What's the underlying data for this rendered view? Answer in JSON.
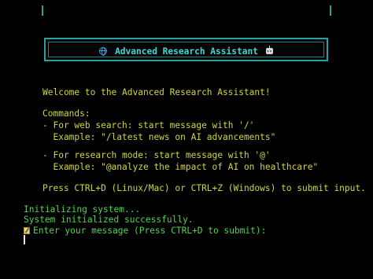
{
  "banner": {
    "title": "Advanced Research Assistant",
    "left_icon": "globe-icon",
    "right_icon": "robot-icon"
  },
  "intro": {
    "welcome": "Welcome to the Advanced Research Assistant!",
    "commands_heading": "Commands:",
    "web_search": "- For web search: start message with '/'",
    "web_search_example": "  Example: \"/latest news on AI advancements\"",
    "research_mode": "- For research mode: start message with '@'",
    "research_mode_example": "  Example: \"@analyze the impact of AI on healthcare\"",
    "submit_hint": "Press CTRL+D (Linux/Mac) or CTRL+Z (Windows) to submit input."
  },
  "status": {
    "initializing": "Initializing system...",
    "initialized": "System initialized successfully.",
    "prompt": "Enter your message (Press CTRL+D to submit):",
    "prompt_icon": "memo-icon"
  },
  "colors": {
    "background": "#000000",
    "banner_border": "#2aa1a1",
    "banner_text": "#41d6d6",
    "intro_text": "#d4d43c",
    "status_text": "#4fd44f"
  }
}
